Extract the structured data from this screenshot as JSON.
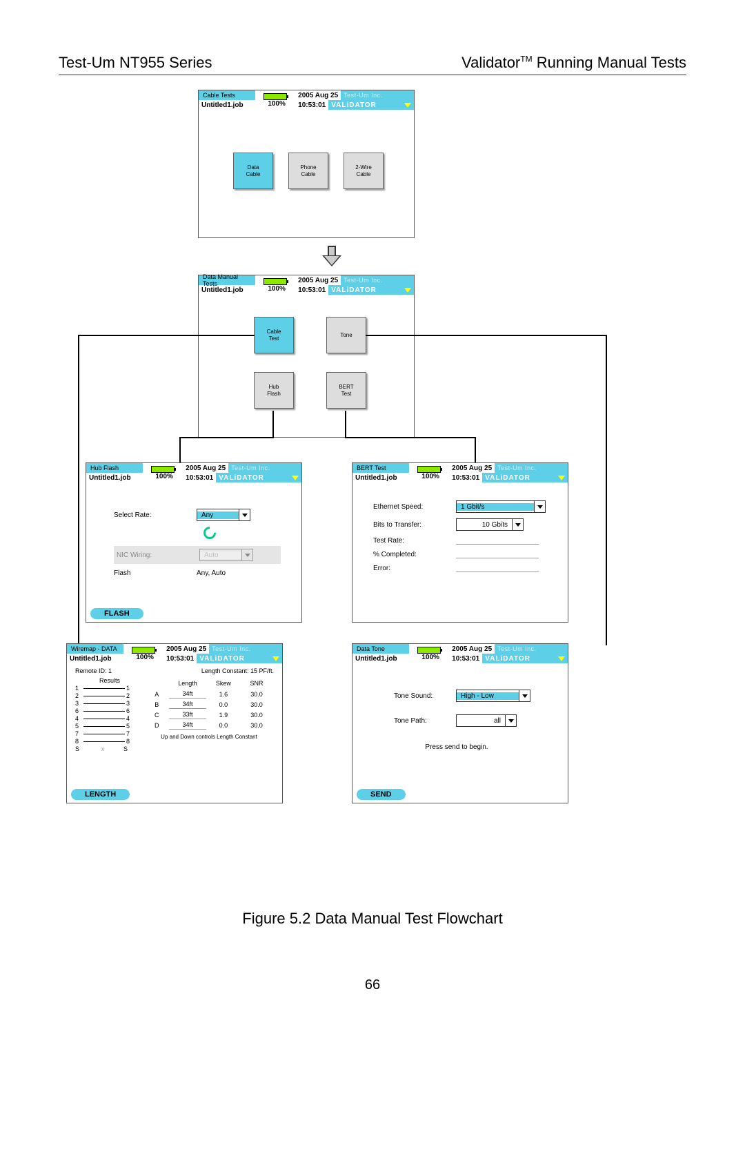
{
  "page": {
    "header_left": "Test-Um NT955 Series",
    "header_right_prefix": "Validator",
    "header_right_tm": "TM",
    "header_right_suffix": " Running Manual Tests",
    "figure_caption": "Figure 5.2 Data Manual Test Flowchart",
    "page_number": "66"
  },
  "common": {
    "job": "Untitled1.job",
    "battery_pct": "100%",
    "date": "2005 Aug 25",
    "time": "10:53:01",
    "brand_top": "Test-Um Inc.",
    "brand_bottom": "VALiDATOR"
  },
  "screen1": {
    "title": "Cable Tests",
    "tiles": {
      "data": "Data\nCable",
      "phone": "Phone\nCable",
      "twowire": "2-Wire\nCable"
    }
  },
  "screen2": {
    "title": "Data Manual Tests",
    "tiles": {
      "cable": "Cable\nTest",
      "tone": "Tone",
      "hub": "Hub\nFlash",
      "bert": "BERT\nTest"
    }
  },
  "hubflash": {
    "title": "Hub Flash",
    "select_rate_label": "Select Rate:",
    "select_rate_value": "Any",
    "nic_label": "NIC Wiring:",
    "nic_value": "Auto",
    "flash_label": "Flash",
    "flash_value": "Any, Auto",
    "button": "FLASH"
  },
  "bert": {
    "title": "BERT Test",
    "speed_label": "Ethernet Speed:",
    "speed_value": "1 Gbit/s",
    "bits_label": "Bits to Transfer:",
    "bits_value": "10 Gbits",
    "rate_label": "Test Rate:",
    "pct_label": "% Completed:",
    "err_label": "Error:"
  },
  "wiremap": {
    "title": "Wiremap - DATA",
    "remote_id_label": "Remote ID: 1",
    "length_const_label": "Length Constant: 15 PF/ft.",
    "col_results": "Results",
    "col_length": "Length",
    "col_skew": "Skew",
    "col_snr": "SNR",
    "rows": [
      {
        "pl": "1",
        "pr": "1",
        "pair": "A",
        "len": "34ft",
        "skew": "1.6",
        "snr": "30.0",
        "p2l": "2",
        "p2r": "2"
      },
      {
        "pl": "3",
        "pr": "3",
        "pair": "B",
        "len": "34ft",
        "skew": "0.0",
        "snr": "30.0",
        "p2l": "6",
        "p2r": "6"
      },
      {
        "pl": "4",
        "pr": "4",
        "pair": "C",
        "len": "33ft",
        "skew": "1.9",
        "snr": "30.0",
        "p2l": "5",
        "p2r": "5"
      },
      {
        "pl": "7",
        "pr": "7",
        "pair": "D",
        "len": "34ft",
        "skew": "0.0",
        "snr": "30.0",
        "p2l": "8",
        "p2r": "8"
      }
    ],
    "shield_l": "S",
    "shield_x": "x",
    "shield_r": "S",
    "note": "Up and Down controls Length Constant",
    "button": "LENGTH"
  },
  "datatone": {
    "title": "Data Tone",
    "sound_label": "Tone Sound:",
    "sound_value": "High - Low",
    "path_label": "Tone Path:",
    "path_value": "all",
    "message": "Press send to begin.",
    "button": "SEND"
  }
}
